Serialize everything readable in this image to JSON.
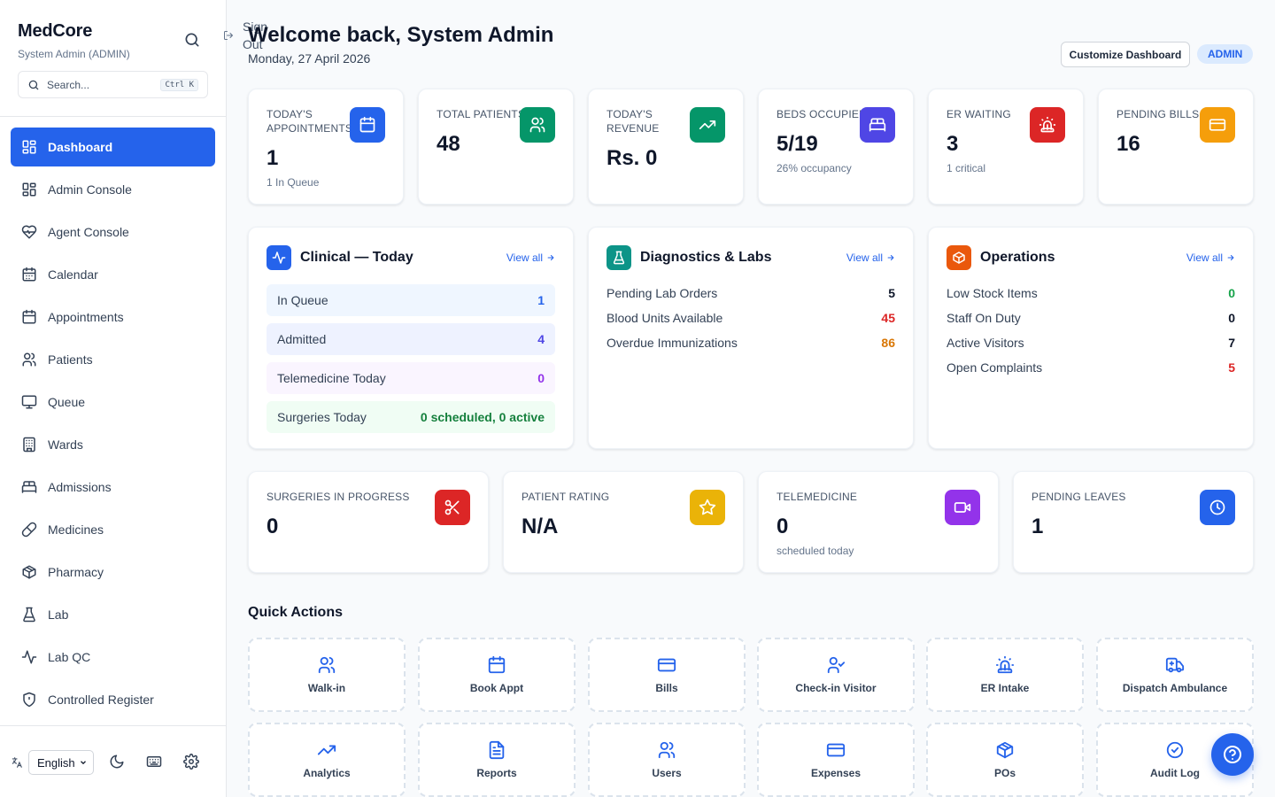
{
  "sidebar": {
    "brand": "MedCore",
    "user": "System Admin (ADMIN)",
    "search_placeholder": "Search...",
    "search_shortcut": "Ctrl K",
    "items": [
      {
        "label": "Dashboard",
        "icon": "dashboard-icon"
      },
      {
        "label": "Admin Console",
        "icon": "grid-icon"
      },
      {
        "label": "Agent Console",
        "icon": "heart-pulse-icon"
      },
      {
        "label": "Calendar",
        "icon": "calendar-icon"
      },
      {
        "label": "Appointments",
        "icon": "calendar-icon"
      },
      {
        "label": "Patients",
        "icon": "users-icon"
      },
      {
        "label": "Queue",
        "icon": "monitor-icon"
      },
      {
        "label": "Wards",
        "icon": "building-icon"
      },
      {
        "label": "Admissions",
        "icon": "bed-icon"
      },
      {
        "label": "Medicines",
        "icon": "pill-icon"
      },
      {
        "label": "Pharmacy",
        "icon": "package-icon"
      },
      {
        "label": "Lab",
        "icon": "flask-icon"
      },
      {
        "label": "Lab QC",
        "icon": "activity-icon"
      },
      {
        "label": "Controlled Register",
        "icon": "shield-icon"
      }
    ],
    "language": "English",
    "signout_label": "Sign Out"
  },
  "header": {
    "welcome": "Welcome back, System Admin",
    "date": "Monday, 27 April 2026",
    "customize_label": "Customize Dashboard",
    "role_badge": "ADMIN"
  },
  "stats_top": [
    {
      "label": "TODAY'S APPOINTMENTS",
      "value": "1",
      "sub": "1 In Queue",
      "color": "#2563eb",
      "icon": "calendar-icon"
    },
    {
      "label": "TOTAL PATIENTS",
      "value": "48",
      "sub": "",
      "color": "#059669",
      "icon": "users-icon"
    },
    {
      "label": "TODAY'S REVENUE",
      "value": "Rs. 0",
      "sub": "",
      "color": "#059669",
      "icon": "trending-up-icon"
    },
    {
      "label": "BEDS OCCUPIED",
      "value": "5/19",
      "sub": "26% occupancy",
      "color": "#4f46e5",
      "icon": "bed-icon"
    },
    {
      "label": "ER WAITING",
      "value": "3",
      "sub": "1 critical",
      "color": "#dc2626",
      "icon": "siren-icon"
    },
    {
      "label": "PENDING BILLS",
      "value": "16",
      "sub": "",
      "color": "#f59e0b",
      "icon": "credit-card-icon"
    }
  ],
  "clinical": {
    "title": "Clinical — Today",
    "view_all": "View all",
    "color": "#2563eb",
    "rows": [
      {
        "label": "In Queue",
        "value": "1",
        "bg": "#eff6ff",
        "fg": "#2563eb"
      },
      {
        "label": "Admitted",
        "value": "4",
        "bg": "#eef2ff",
        "fg": "#4f46e5"
      },
      {
        "label": "Telemedicine Today",
        "value": "0",
        "bg": "#faf5ff",
        "fg": "#9333ea"
      },
      {
        "label": "Surgeries Today",
        "value": "0 scheduled, 0 active",
        "bg": "#f0fdf4",
        "fg": "#15803d"
      }
    ]
  },
  "diagnostics": {
    "title": "Diagnostics & Labs",
    "view_all": "View all",
    "color": "#0d9488",
    "rows": [
      {
        "label": "Pending Lab Orders",
        "value": "5",
        "fg": "#0f172a"
      },
      {
        "label": "Blood Units Available",
        "value": "45",
        "fg": "#dc2626"
      },
      {
        "label": "Overdue Immunizations",
        "value": "86",
        "fg": "#d97706"
      }
    ]
  },
  "operations": {
    "title": "Operations",
    "view_all": "View all",
    "color": "#ea580c",
    "rows": [
      {
        "label": "Low Stock Items",
        "value": "0",
        "fg": "#16a34a"
      },
      {
        "label": "Staff On Duty",
        "value": "0",
        "fg": "#0f172a"
      },
      {
        "label": "Active Visitors",
        "value": "7",
        "fg": "#0f172a"
      },
      {
        "label": "Open Complaints",
        "value": "5",
        "fg": "#dc2626"
      }
    ]
  },
  "stats_bottom": [
    {
      "label": "SURGERIES IN PROGRESS",
      "value": "0",
      "sub": "",
      "color": "#dc2626",
      "icon": "scissors-icon"
    },
    {
      "label": "PATIENT RATING",
      "value": "N/A",
      "sub": "",
      "color": "#eab308",
      "icon": "star-icon"
    },
    {
      "label": "TELEMEDICINE",
      "value": "0",
      "sub": "scheduled today",
      "color": "#9333ea",
      "icon": "video-icon"
    },
    {
      "label": "PENDING LEAVES",
      "value": "1",
      "sub": "",
      "color": "#2563eb",
      "icon": "clock-icon"
    }
  ],
  "quick_actions": {
    "title": "Quick Actions",
    "items": [
      {
        "label": "Walk-in",
        "icon": "users-icon"
      },
      {
        "label": "Book Appt",
        "icon": "calendar-icon"
      },
      {
        "label": "Bills",
        "icon": "credit-card-icon"
      },
      {
        "label": "Check-in Visitor",
        "icon": "user-check-icon"
      },
      {
        "label": "ER Intake",
        "icon": "siren-icon"
      },
      {
        "label": "Dispatch Ambulance",
        "icon": "ambulance-icon"
      },
      {
        "label": "Analytics",
        "icon": "trending-up-icon"
      },
      {
        "label": "Reports",
        "icon": "file-text-icon"
      },
      {
        "label": "Users",
        "icon": "users-icon"
      },
      {
        "label": "Expenses",
        "icon": "credit-card-icon"
      },
      {
        "label": "POs",
        "icon": "package-icon"
      },
      {
        "label": "Audit Log",
        "icon": "check-circle-icon"
      }
    ]
  }
}
